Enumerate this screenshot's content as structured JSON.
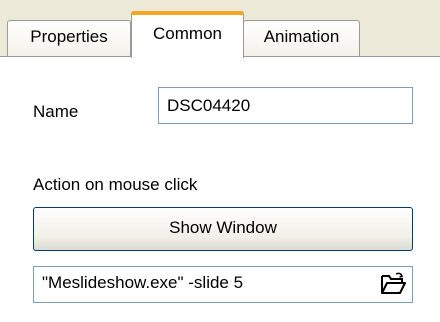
{
  "tabs": [
    {
      "label": "Properties",
      "active": false
    },
    {
      "label": "Common",
      "active": true
    },
    {
      "label": "Animation",
      "active": false
    }
  ],
  "form": {
    "name_label": "Name",
    "name_value": "DSC04420",
    "action_label": "Action on mouse click",
    "action_button": "Show Window",
    "command_value": "\"Meslideshow.exe\" -slide 5"
  },
  "icons": {
    "browse": "open-folder-icon"
  },
  "colors": {
    "tab_strip_bg": "#ece9d8",
    "active_tab_accent": "#f5a623",
    "input_border": "#7f9db9",
    "button_border": "#003c74"
  }
}
